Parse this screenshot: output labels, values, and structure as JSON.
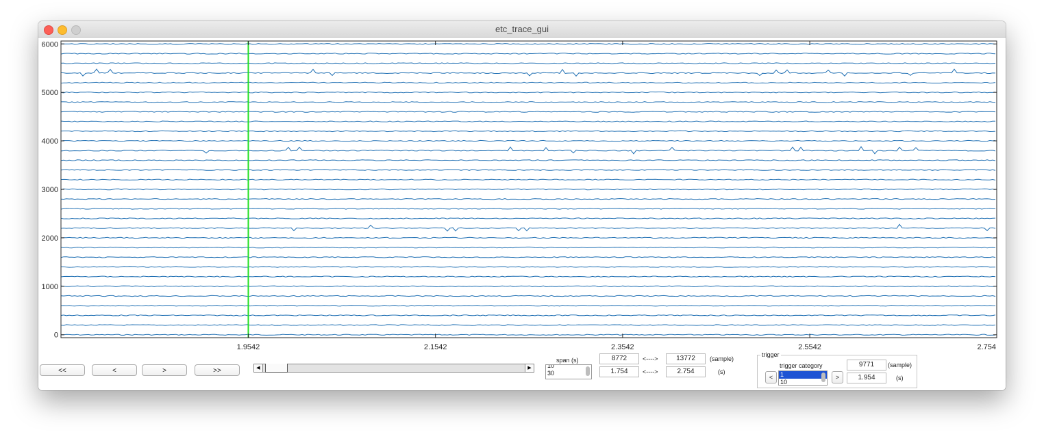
{
  "window": {
    "title": "etc_trace_gui"
  },
  "chart_data": {
    "type": "line",
    "description_free": true,
    "y_ticks": [
      "0",
      "1000",
      "2000",
      "3000",
      "4000",
      "5000",
      "6000"
    ],
    "y_tick_values": [
      0,
      1000,
      2000,
      3000,
      4000,
      5000,
      6000
    ],
    "ylim": [
      -60,
      6060
    ],
    "x_ticks": [
      "1.9542",
      "2.1542",
      "2.3542",
      "2.5542",
      "2.754"
    ],
    "x_tick_values": [
      1.9542,
      2.1542,
      2.3542,
      2.5542,
      2.754
    ],
    "xlim": [
      1.754,
      2.754
    ],
    "n_traces": 31,
    "trace_spacing": 200,
    "trace_color": "#1f6fb3",
    "cursor_x": 1.9542,
    "cursor_color": "#22e022",
    "grid": false
  },
  "nav": {
    "first": "<<",
    "prev": "<",
    "next": ">",
    "last": ">>"
  },
  "span": {
    "label": "span (s)",
    "options": [
      "10",
      "30"
    ]
  },
  "range": {
    "start_sample": "8772",
    "end_sample": "13772",
    "arrow": "<---->",
    "sample_unit": "(sample)",
    "start_time": "1.754",
    "end_time": "2.754",
    "time_unit": "(s)"
  },
  "trigger": {
    "group_title": "trigger",
    "category_label": "trigger category",
    "prev": "<",
    "next": ">",
    "categories": [
      "1",
      "10"
    ],
    "sample_value": "9771",
    "sample_unit": "(sample)",
    "time_value": "1.954",
    "time_unit": "(s)"
  }
}
